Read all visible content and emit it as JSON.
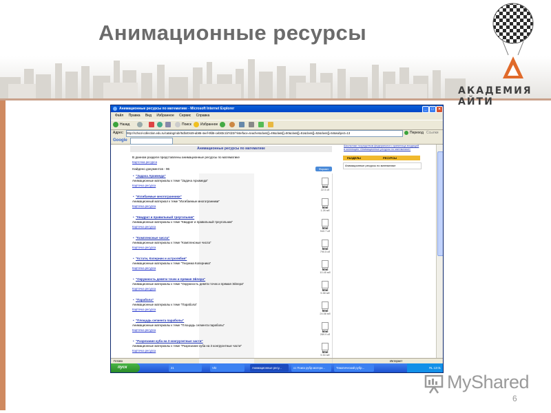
{
  "slide": {
    "title": "Анимационные ресурсы",
    "logo_text": "АКАДЕМИЯ АЙТИ",
    "page_number": "6",
    "watermark": "MyShared"
  },
  "browser": {
    "window_title": "Анимационные ресурсы по математике - Microsoft Internet Explorer",
    "menu": [
      "Файл",
      "Правка",
      "Вид",
      "Избранное",
      "Сервис",
      "Справка"
    ],
    "toolbar": {
      "back": "Назад",
      "search": "Поиск",
      "favorites": "Избранное"
    },
    "address_label": "Адрес:",
    "address_value": "http://school-collection.edu.ru/catalog/rubr/5db40449-ab86-4eef-9fd6-ceb83c1b7d23/?interface=teacher&class[]=49&class[]=50&class[]=51&class[]=52&class[]=54&subject=13",
    "go_label": "Переход",
    "links_label": "Ссылки",
    "google_label": "Google"
  },
  "content": {
    "header": "Анимационные ресурсы по математике",
    "intro": "В данном разделе представлены анимационные ресурсы по математике",
    "intro_link": "Карточка ресурса",
    "found": "Найдено документов - 96",
    "format_header": "Формат",
    "items": [
      {
        "title": "\"Задача Архимеда\"",
        "desc": "Анимационные материалы к теме \"Задача Архимеда\"",
        "card": "Карточка ресурса",
        "fmt": "html",
        "size": "22.5 кб"
      },
      {
        "title": "\"Изгибаемые многогранники\"",
        "desc": "Анимационный материал к теме \"Изгибаемые многогранники\"",
        "card": "Карточка ресурса",
        "fmt": "html",
        "size": "1.26 мб"
      },
      {
        "title": "\"Квадрат и правильный треугольник\"",
        "desc": "Анимационные материалы к теме \"Квадрат и правильный треугольник\"",
        "card": "Карточка ресурса",
        "fmt": "html",
        "size": "940.7 кб"
      },
      {
        "title": "\"Комплексные числа\"",
        "desc": "Анимационные материалы к теме \"Комплексные числа\"",
        "card": "Карточка ресурса",
        "fmt": "html",
        "size": "790.5 кб"
      },
      {
        "title": "\"Кстати, Коперник и астролябия\"",
        "desc": "Анимационные материалы к теме \"Теорема Коперника\"",
        "card": "Карточка ресурса",
        "fmt": "html",
        "size": "10.45 мб"
      },
      {
        "title": "\"Окружность девяти точек и прямая Эйлера\"",
        "desc": "Анимационные материалы к теме \"Окружность девяти точек и прямая Эйлера\"",
        "card": "Карточка ресурса",
        "fmt": "html",
        "size": "5.58 мб"
      },
      {
        "title": "\"Парабола\"",
        "desc": "Анимационные материалы к теме \"Парабола\"",
        "card": "Карточка ресурса",
        "fmt": "html",
        "size": "24.58 мб"
      },
      {
        "title": "\"Площадь сегмента параболы\"",
        "desc": "Анимационные материалы к теме \"Площадь сегмента параболы\"",
        "card": "Карточка ресурса",
        "fmt": "html",
        "size": "289.9 кб"
      },
      {
        "title": "\"Разрезание куба на 3 конгруэнтные части\"",
        "desc": "Анимационные материалы к теме \"Разрезание куба на 3 конгруэнтные части\"",
        "card": "Карточка ресурса",
        "fmt": "html",
        "size": "5.54 мб"
      }
    ],
    "sidebar": {
      "links": "Школьники посредством федерального хранилища входящей в коллекцию «Анимационные ресурсы по математике»",
      "col1": "РАЗДЕЛЫ",
      "col2": "РЕСУРСЫ",
      "selected": "Анимационные ресурсы по математике"
    }
  },
  "statusbar": {
    "left": "Готово",
    "right": "Интернет"
  },
  "taskbar": {
    "start": "пуск",
    "tasks": [
      "21",
      "Vkt",
      "Анимационные ресу...",
      "cc Поиск рубр матери...",
      "Тематический рубр..."
    ],
    "tray": "RL 13:01"
  },
  "colors": {
    "accent": "#cf8a60",
    "title_gray": "#6b6b6b",
    "xp_blue": "#0a5ed7"
  }
}
